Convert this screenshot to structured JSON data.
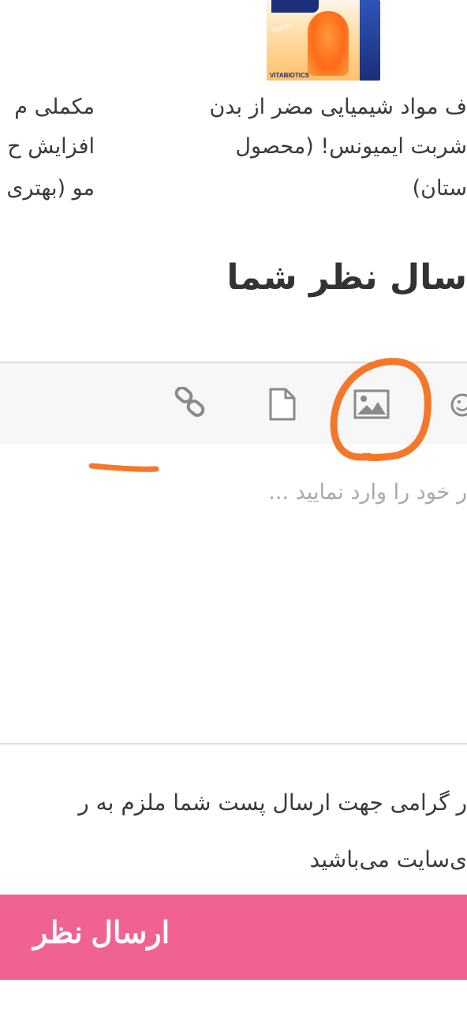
{
  "article_cards": [
    {
      "lines": [
        "ف مواد شیمیایی مضر از بدن",
        "شربت ایمیونس! (محصول",
        "ستان)"
      ]
    },
    {
      "lines": [
        "مکملی م",
        "افزایش ح",
        "مو (بهتری"
      ]
    }
  ],
  "product_image": {
    "watermark": "Daroo",
    "brand": "VITABIOTICS"
  },
  "comment_form": {
    "title": "سال نظر شما",
    "toolbar_icons": [
      "link-icon",
      "file-icon",
      "image-icon",
      "emoji-icon"
    ],
    "placeholder": "ر خود را وارد نمایید ...",
    "notice_line1": "ر گرامی جهت ارسال پست شما ملزم به ر",
    "notice_line2": "ی‌سایت می‌باشید",
    "submit_label": "ارسال نظر"
  },
  "annotations": {
    "color": "#f5782a"
  },
  "colors": {
    "submit_bg": "#f06292",
    "toolbar_bg": "#f7f7f7"
  }
}
